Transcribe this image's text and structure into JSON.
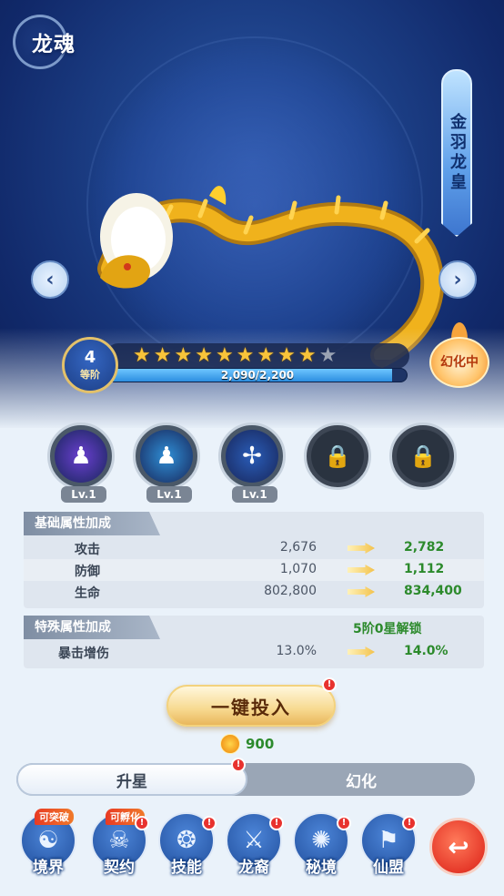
{
  "header": {
    "title": "龙魂"
  },
  "dragon": {
    "name": "金羽龙皇"
  },
  "grade": {
    "level": "4",
    "label": "等阶"
  },
  "stars": {
    "filled": 9,
    "total": 10
  },
  "exp": {
    "text": "2,090/2,200",
    "progress": 0.95
  },
  "status": {
    "label": "幻化中"
  },
  "skills": [
    {
      "icon": "body-aura-skill-icon",
      "level": "Lv.1",
      "locked": false,
      "color": "#6a3fd0"
    },
    {
      "icon": "water-aura-skill-icon",
      "level": "Lv.1",
      "locked": false,
      "color": "#2f8fd6"
    },
    {
      "icon": "crossbow-skill-icon",
      "level": "Lv.1",
      "locked": false,
      "color": "#2a5db8"
    },
    {
      "icon": "lock-icon",
      "level": "",
      "locked": true
    },
    {
      "icon": "lock-icon",
      "level": "",
      "locked": true
    }
  ],
  "base_attrs": {
    "title": "基础属性加成",
    "rows": [
      {
        "name": "攻击",
        "current": "2,676",
        "next": "2,782"
      },
      {
        "name": "防御",
        "current": "1,070",
        "next": "1,112"
      },
      {
        "name": "生命",
        "current": "802,800",
        "next": "834,400"
      }
    ]
  },
  "special_attrs": {
    "title": "特殊属性加成",
    "unlock_text": "5阶0星解锁",
    "rows": [
      {
        "name": "暴击增伤",
        "current": "13.0%",
        "next": "14.0%"
      }
    ]
  },
  "action": {
    "label": "一键投入",
    "cost": "900",
    "alert": "!"
  },
  "tabs": [
    {
      "label": "升星",
      "active": true
    },
    {
      "label": "幻化",
      "active": false
    }
  ],
  "bottom_nav": [
    {
      "label": "境界",
      "tag": "可突破",
      "icon": "sage-icon"
    },
    {
      "label": "契约",
      "tag": "可孵化",
      "icon": "beast-icon"
    },
    {
      "label": "技能",
      "tag": "",
      "icon": "swirl-icon"
    },
    {
      "label": "龙裔",
      "tag": "",
      "icon": "warrior-icon"
    },
    {
      "label": "秘境",
      "tag": "",
      "icon": "vortex-icon"
    },
    {
      "label": "仙盟",
      "tag": "",
      "icon": "banner-icon"
    }
  ],
  "colors": {
    "accent_gold": "#f8c43a",
    "bg_blue": "#1c3f86",
    "green_value": "#2c8a2c",
    "alert_red": "#e8322e"
  }
}
